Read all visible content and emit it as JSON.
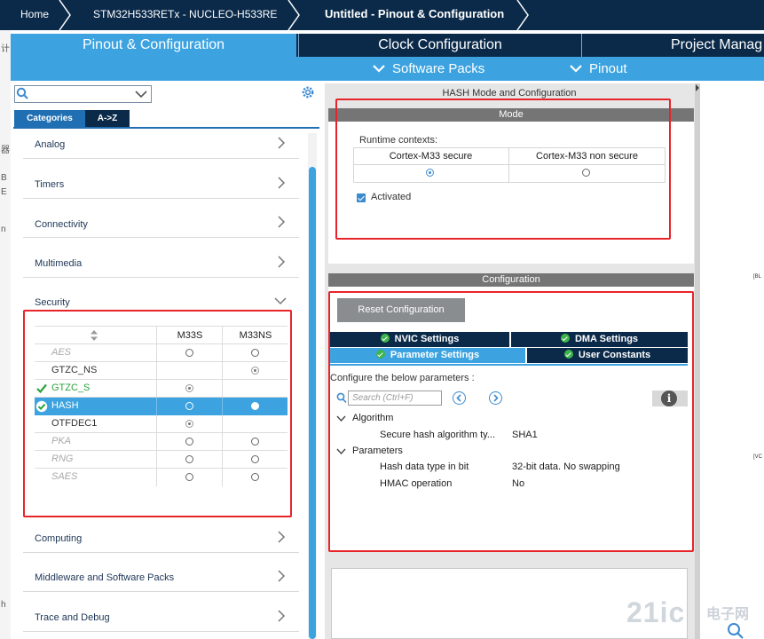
{
  "breadcrumb": {
    "home": "Home",
    "board": "STM32H533RETx  -  NUCLEO-H533RE",
    "project": "Untitled - Pinout & Configuration"
  },
  "tabs": {
    "pinout": "Pinout & Configuration",
    "clock": "Clock Configuration",
    "project": "Project Manag"
  },
  "subtabs": {
    "software_packs": "Software Packs",
    "pinout": "Pinout"
  },
  "left_panel": {
    "category_tabs": [
      "Categories",
      "A->Z"
    ],
    "categories": {
      "analog": "Analog",
      "timers": "Timers",
      "connectivity": "Connectivity",
      "multimedia": "Multimedia",
      "security": "Security",
      "computing": "Computing",
      "middleware": "Middleware and Software Packs",
      "trace": "Trace and Debug"
    },
    "security_table": {
      "col_m33s": "M33S",
      "col_m33ns": "M33NS",
      "rows": [
        {
          "name": "AES"
        },
        {
          "name": "GTZC_NS"
        },
        {
          "name": "GTZC_S"
        },
        {
          "name": "HASH"
        },
        {
          "name": "OTFDEC1"
        },
        {
          "name": "PKA"
        },
        {
          "name": "RNG"
        },
        {
          "name": "SAES"
        }
      ]
    }
  },
  "hash_panel": {
    "title": "HASH Mode and Configuration",
    "mode_header": "Mode",
    "runtime_label": "Runtime contexts:",
    "col_secure": "Cortex-M33 secure",
    "col_nonsecure": "Cortex-M33 non secure",
    "activated_label": "Activated",
    "config_header": "Configuration",
    "reset_button": "Reset Configuration",
    "tabs": {
      "nvic": "NVIC Settings",
      "dma": "DMA Settings",
      "params": "Parameter Settings",
      "user_constants": "User Constants"
    },
    "configure_text": "Configure the below parameters :",
    "search_placeholder": "Search (Ctrl+F)",
    "algorithm_group": "Algorithm",
    "algorithm_param": "Secure hash algorithm ty...",
    "algorithm_value": "SHA1",
    "parameters_group": "Parameters",
    "datatype_param": "Hash data type in bit",
    "datatype_value": "32-bit data. No swapping",
    "hmac_param": "HMAC operation",
    "hmac_value": "No"
  },
  "right_labels": [
    "[BL",
    "[VC"
  ],
  "watermark": {
    "main": "21ic",
    "sub": "电子网"
  },
  "left_strip_glyphs": [
    "计",
    "器",
    "B",
    "E",
    "n",
    "h"
  ],
  "colors": {
    "navy": "#0b2a4a",
    "accent": "#3ca3e0",
    "highlight_box": "#e8242b",
    "ok_green": "#29a33a"
  }
}
